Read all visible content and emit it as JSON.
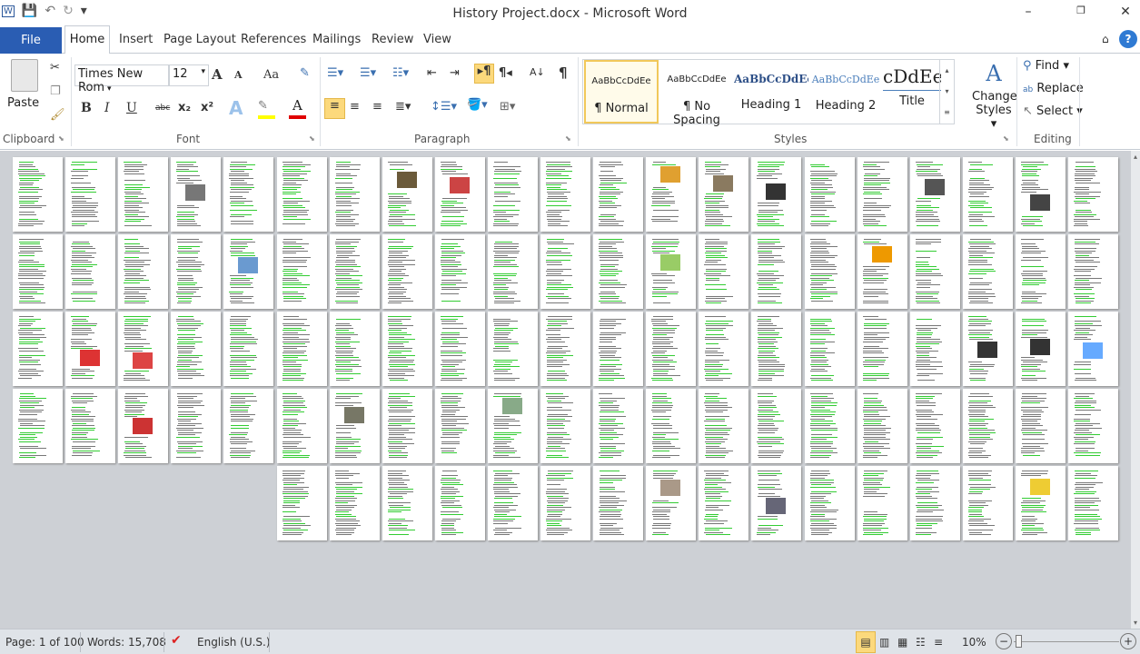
{
  "window": {
    "title": "History Project.docx - Microsoft Word",
    "minimize": "–",
    "restore": "❐",
    "close": "✕"
  },
  "qat": {
    "word_icon": "W",
    "save": "💾",
    "undo": "↶",
    "redo": "↻",
    "customize": "▾"
  },
  "tabs": {
    "file": "File",
    "items": [
      "Home",
      "Insert",
      "Page Layout",
      "References",
      "Mailings",
      "Review",
      "View"
    ],
    "active": "Home"
  },
  "clipboard": {
    "paste": "Paste",
    "label": "Clipboard"
  },
  "font": {
    "name": "Times New Rom",
    "size": "12",
    "label": "Font",
    "bold": "B",
    "italic": "I",
    "underline": "U",
    "strike": "abc",
    "sub": "x₂",
    "sup": "x²",
    "grow": "A",
    "shrink": "A",
    "case": "Aa",
    "color_text": "A",
    "highlight_color": "#ffff00",
    "font_color": "#e00000"
  },
  "paragraph": {
    "label": "Paragraph",
    "pilcrow": "¶",
    "ltr": "▸¶",
    "rtl": "¶◂",
    "sort": "A↓"
  },
  "styles": {
    "label": "Styles",
    "items": [
      {
        "sample": "AaBbCcDdEe",
        "name": "¶ Normal"
      },
      {
        "sample": "AaBbCcDdEe",
        "name": "¶ No Spacing"
      },
      {
        "sample": "AaBbCcDdEe",
        "name": "Heading 1"
      },
      {
        "sample": "AaBbCcDdEe",
        "name": "Heading 2"
      },
      {
        "sample": "cDdEe",
        "name": "Title"
      }
    ],
    "active": "¶ Normal",
    "change_line1": "Change",
    "change_line2": "Styles ▾"
  },
  "editing": {
    "label": "Editing",
    "find": "Find ▾",
    "replace": "Replace",
    "select": "Select ▾"
  },
  "document": {
    "page_count": 100,
    "pages_per_row": 21
  },
  "status": {
    "page": "Page: 1 of 100",
    "words": "Words: 15,708",
    "language": "English (U.S.)",
    "zoom": "10%",
    "zoom_minus": "−",
    "zoom_plus": "+"
  },
  "colors": {
    "accent": "#2a5db3",
    "highlight": "#fcd97c",
    "doc_bg": "#cdd0d5"
  }
}
